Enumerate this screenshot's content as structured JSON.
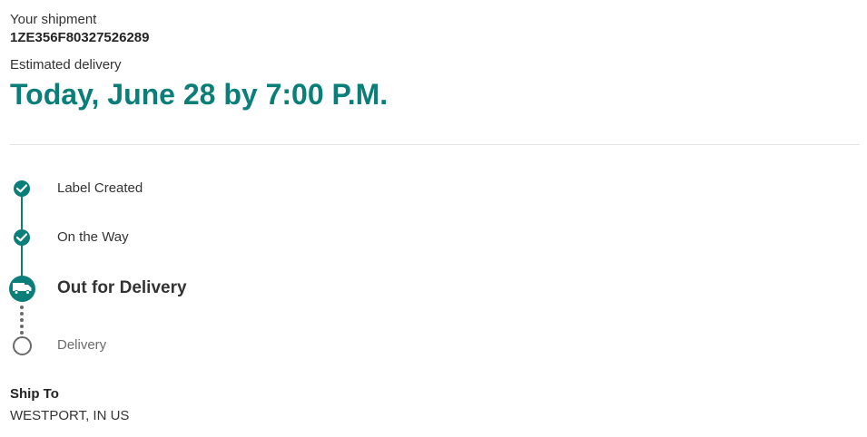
{
  "shipment": {
    "heading": "Your shipment",
    "tracking_number": "1ZE356F80327526289"
  },
  "delivery": {
    "label": "Estimated delivery",
    "date": "Today, June 28 by 7:00 P.M."
  },
  "timeline": {
    "steps": [
      {
        "label": "Label Created",
        "status": "complete",
        "icon": "check-icon"
      },
      {
        "label": "On the Way",
        "status": "complete",
        "icon": "check-icon"
      },
      {
        "label": "Out for Delivery",
        "status": "current",
        "icon": "truck-icon"
      },
      {
        "label": "Delivery",
        "status": "pending",
        "icon": "empty-circle-icon"
      }
    ]
  },
  "ship_to": {
    "label": "Ship To",
    "address": "WESTPORT, IN US"
  },
  "colors": {
    "accent": "#0a7e78",
    "pending": "#6b6b6b",
    "divider": "#e3e3e3"
  }
}
